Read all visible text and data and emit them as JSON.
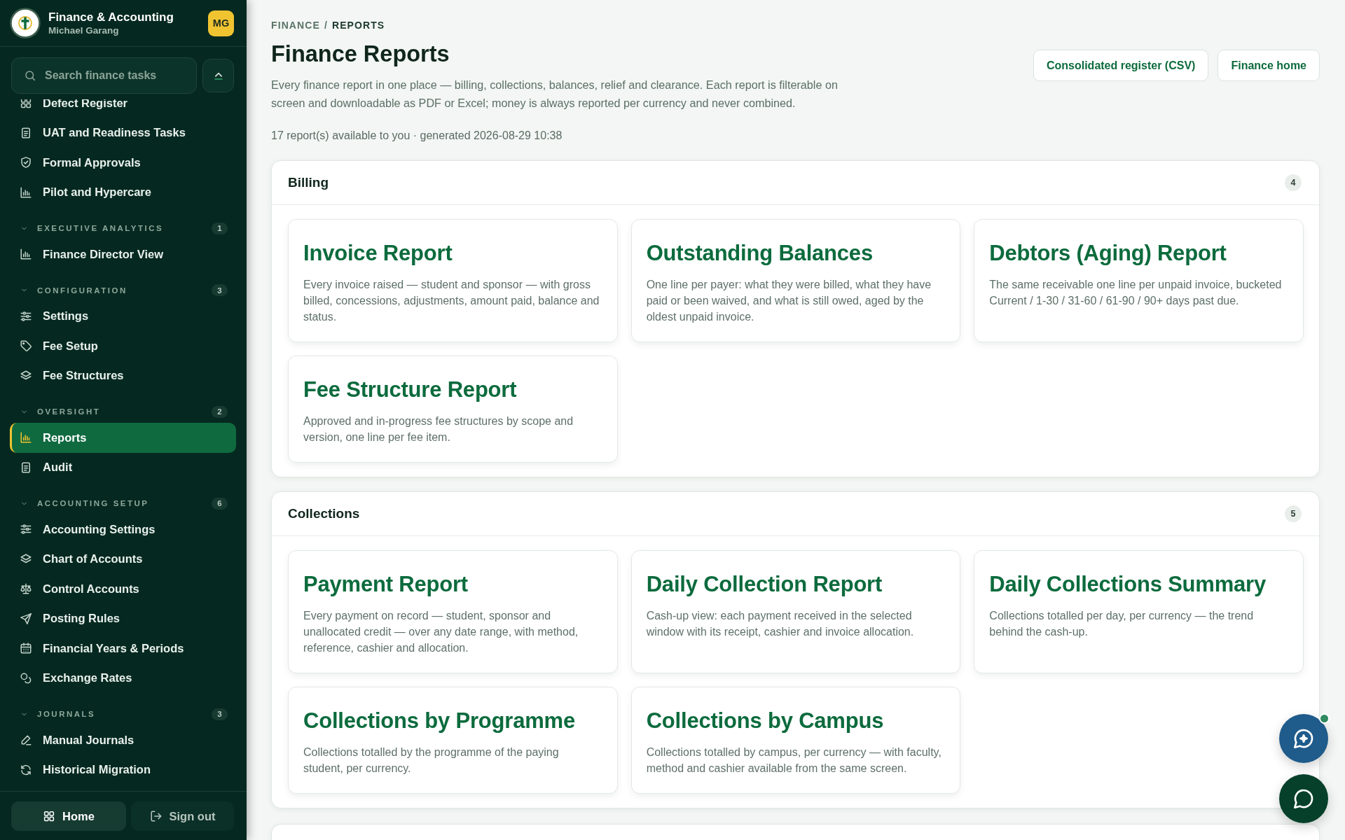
{
  "sidebar": {
    "app_title": "Finance & Accounting",
    "user_name": "Michael Garang",
    "user_initials": "MG",
    "search": {
      "placeholder": "Search finance tasks"
    },
    "nav_groups": [
      {
        "items": [
          {
            "label": "Defect Register",
            "selected": false
          },
          {
            "label": "UAT and Readiness Tasks",
            "selected": false
          },
          {
            "label": "Formal Approvals",
            "selected": false
          },
          {
            "label": "Pilot and Hypercare",
            "selected": false
          }
        ]
      },
      {
        "title": "EXECUTIVE ANALYTICS",
        "count": "1",
        "expanded": true,
        "items": [
          {
            "label": "Finance Director View",
            "selected": false
          }
        ]
      },
      {
        "title": "CONFIGURATION",
        "count": "3",
        "expanded": true,
        "items": [
          {
            "label": "Settings",
            "selected": false
          },
          {
            "label": "Fee Setup",
            "selected": false
          },
          {
            "label": "Fee Structures",
            "selected": false
          }
        ]
      },
      {
        "title": "OVERSIGHT",
        "count": "2",
        "expanded": true,
        "items": [
          {
            "label": "Reports",
            "selected": true
          },
          {
            "label": "Audit",
            "selected": false
          }
        ]
      },
      {
        "title": "ACCOUNTING SETUP",
        "count": "6",
        "expanded": true,
        "items": [
          {
            "label": "Accounting Settings",
            "selected": false
          },
          {
            "label": "Chart of Accounts",
            "selected": false
          },
          {
            "label": "Control Accounts",
            "selected": false
          },
          {
            "label": "Posting Rules",
            "selected": false
          },
          {
            "label": "Financial Years & Periods",
            "selected": false
          },
          {
            "label": "Exchange Rates",
            "selected": false
          }
        ]
      },
      {
        "title": "JOURNALS",
        "count": "3",
        "expanded": true,
        "items": [
          {
            "label": "Manual Journals",
            "selected": false
          },
          {
            "label": "Historical Migration",
            "selected": false
          }
        ]
      }
    ],
    "footer_buttons": [
      {
        "label": "Home",
        "kind": "home"
      },
      {
        "label": "Sign out",
        "kind": "signout"
      }
    ]
  },
  "breadcrumb": {
    "separator": "/",
    "items": [
      {
        "label": "FINANCE",
        "current": false
      },
      {
        "label": "REPORTS",
        "current": true
      }
    ]
  },
  "page": {
    "title": "Finance Reports",
    "description": "Every finance report in one place — billing, collections, balances, relief and clearance. Each report is filterable on screen and downloadable as PDF or Excel; money is always reported per currency and never combined.",
    "meta": "17 report(s) available to you · generated 2026-08-29 10:38"
  },
  "header_buttons": [
    "Consolidated register (CSV)",
    "Finance home"
  ],
  "sections": [
    {
      "title": "Billing",
      "count": "4",
      "reports": [
        {
          "title": "Invoice Report",
          "description": "Every invoice raised — student and sponsor — with gross billed, concessions, adjustments, amount paid, balance and status."
        },
        {
          "title": "Outstanding Balances",
          "description": "One line per payer: what they were billed, what they have paid or been waived, and what is still owed, aged by the oldest unpaid invoice."
        },
        {
          "title": "Debtors (Aging) Report",
          "description": "The same receivable one line per unpaid invoice, bucketed Current / 1-30 / 31-60 / 61-90 / 90+ days past due."
        },
        {
          "title": "Fee Structure Report",
          "description": "Approved and in-progress fee structures by scope and version, one line per fee item."
        }
      ]
    },
    {
      "title": "Collections",
      "count": "5",
      "reports": [
        {
          "title": "Payment Report",
          "description": "Every payment on record — student, sponsor and unallocated credit — over any date range, with method, reference, cashier and allocation."
        },
        {
          "title": "Daily Collection Report",
          "description": "Cash-up view: each payment received in the selected window with its receipt, cashier and invoice allocation."
        },
        {
          "title": "Daily Collections Summary",
          "description": "Collections totalled per day, per currency — the trend behind the cash-up."
        },
        {
          "title": "Collections by Programme",
          "description": "Collections totalled by the programme of the paying student, per currency."
        },
        {
          "title": "Collections by Campus",
          "description": "Collections totalled by campus, per currency — with faculty, method and cashier available from the same screen."
        }
      ]
    }
  ],
  "more_sections_below": true,
  "floating_buttons": [
    {
      "kind": "assistant",
      "notification": true
    },
    {
      "kind": "chat",
      "notification": false
    }
  ]
}
